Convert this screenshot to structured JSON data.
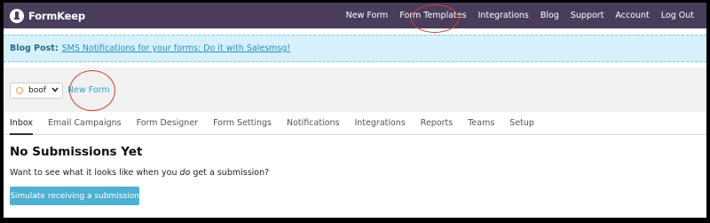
{
  "nav": {
    "brand": "FormKeep",
    "links": [
      "New Form",
      "Form Templates",
      "Integrations",
      "Blog",
      "Support",
      "Account",
      "Log Out"
    ]
  },
  "blog": {
    "label": "Blog Post:",
    "link": "SMS Notifications for your forms: Do it with Salesmsg!"
  },
  "form_selector": {
    "value": "boof"
  },
  "new_form_link": "New Form",
  "tabs": [
    "Inbox",
    "Email Campaigns",
    "Form Designer",
    "Form Settings",
    "Notifications",
    "Integrations",
    "Reports",
    "Teams",
    "Setup"
  ],
  "active_tab": "Inbox",
  "content": {
    "title": "No Submissions Yet",
    "desc_before": "Want to see what it looks like when you ",
    "desc_em": "do",
    "desc_after": " get a submission?",
    "button": "Simulate receiving a submission"
  },
  "colors": {
    "nav_bg": "#4a3d5c",
    "banner_bg": "#d6f1fb",
    "link": "#3aa0d0",
    "button_bg": "#4eb1d2",
    "annotation_circle": "#c9442e"
  },
  "icons": {
    "brand": "formkeep-logo-icon",
    "select_status": "circle-icon",
    "select_caret": "chevron-down-icon"
  }
}
